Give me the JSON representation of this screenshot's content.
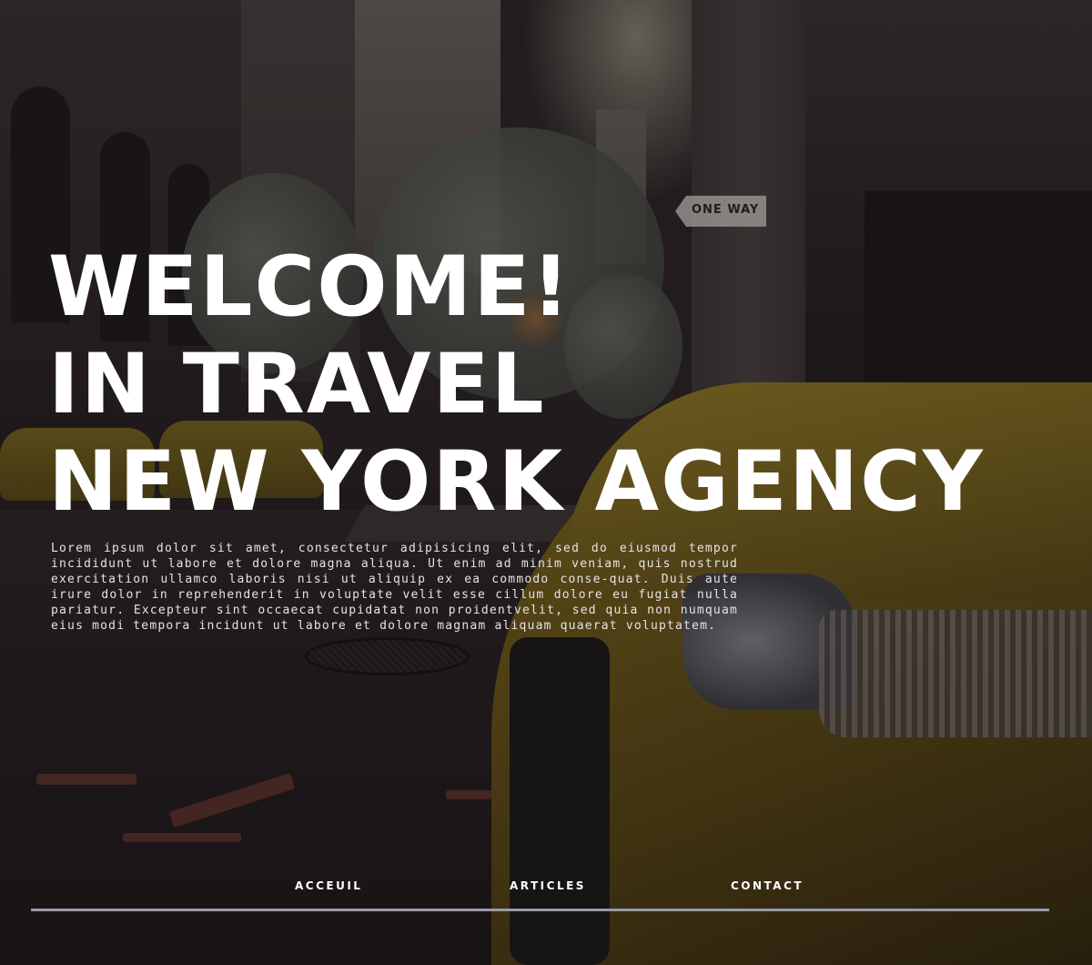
{
  "hero": {
    "headline_line1": "WELCOME!",
    "headline_line2": "IN TRAVEL",
    "headline_line3": "NEW YORK AGENCY",
    "intro": "Lorem ipsum dolor sit amet, consectetur adipisicing elit, sed do eiusmod tempor incididunt ut labore et dolore magna aliqua. Ut enim ad minim veniam, quis nostrud exercitation ullamco laboris nisi ut aliquip ex ea commodo conse-quat. Duis aute irure dolor in reprehenderit in voluptate velit esse cillum dolore eu fugiat nulla pariatur. Excepteur sint occaecat cupidatat non proidentvelit, sed quia non numquam eius modi tempora incidunt ut labore et dolore magnam aliquam quaerat voluptatem.",
    "background_sign_text": "ONE WAY"
  },
  "nav": {
    "items": [
      {
        "label": "ACCEUIL"
      },
      {
        "label": "ARTICLES"
      },
      {
        "label": "CONTACT"
      }
    ]
  },
  "colors": {
    "text": "#ffffff",
    "nav_underline": "#9a9aa6",
    "taxi_yellow": "#8a7420"
  }
}
